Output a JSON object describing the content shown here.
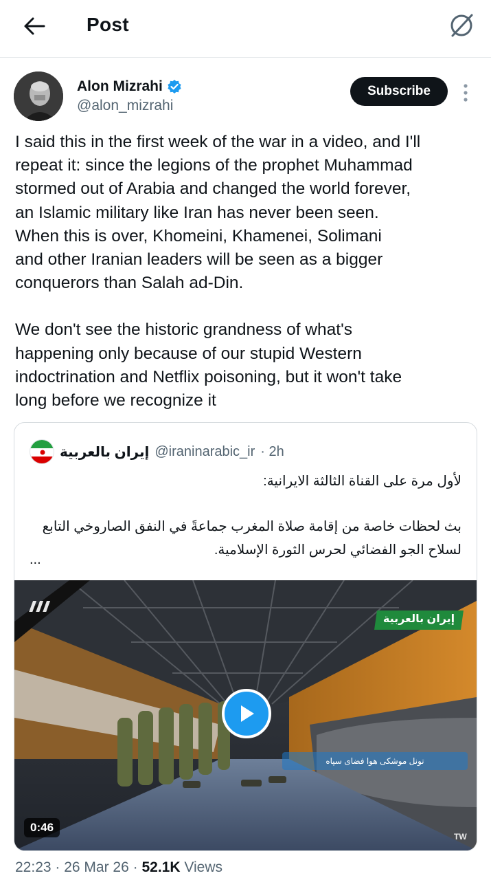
{
  "header": {
    "title": "Post",
    "back_icon": "arrow-left-icon",
    "grok_icon": "grok-icon"
  },
  "author": {
    "display_name": "Alon Mizrahi",
    "handle": "@alon_mizrahi",
    "verified": true,
    "subscribe_label": "Subscribe"
  },
  "tweet": {
    "lines_p1": [
      "I said this in the first week of the war in a video, and I'll",
      "repeat it: since the legions of the prophet Muhammad",
      "stormed out of Arabia and changed the world forever,",
      "an Islamic military like Iran has never been seen.",
      "When this is over, Khomeini, Khamenei, Solimani",
      "and other Iranian leaders will be seen as a bigger",
      "conquerors than Salah ad-Din."
    ],
    "lines_p2": [
      "We don't see the historic grandness of what's",
      "happening only because of our stupid Western",
      "indoctrination and Netflix poisoning, but it won't take",
      "long before we recognize it"
    ]
  },
  "quote": {
    "name": "إيران بالعربية",
    "handle": "@iraninarabic_ir",
    "time": "· 2h",
    "line1": "لأول مرة على القناة الثالثة الايرانية:",
    "line2": "بث لحظات خاصة من إقامة صلاة المغرب جماعةً في النفق الصاروخي التابع لسلاح الجو الفضائي لحرس الثورة الإسلامية.",
    "ellipsis": "...",
    "video": {
      "duration": "0:46",
      "watermark": "TW",
      "channel_logo": "إيران بالعربية",
      "caption": "تونل موشکی هوا فضای سپاه"
    }
  },
  "meta": {
    "time": "22:23",
    "date": "26 Mar 26",
    "views_count": "52.1K",
    "views_label": "Views"
  },
  "colors": {
    "accent": "#1d9bf0",
    "text": "#0f1419",
    "muted": "#536471",
    "border": "#d6dbdf"
  }
}
